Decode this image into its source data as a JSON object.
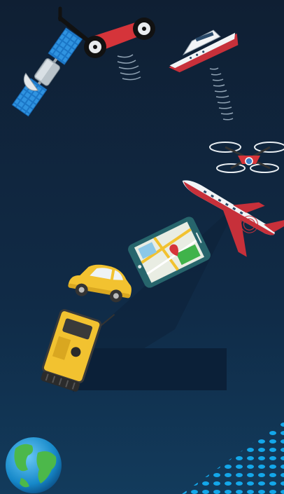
{
  "scene": {
    "elements": [
      "satellite-icon",
      "measuring-wheel-icon",
      "boat-icon",
      "drone-icon",
      "jet-icon",
      "smartphone-map-icon",
      "car-icon",
      "total-station-icon",
      "globe-icon"
    ],
    "colors": {
      "background_top": "#0f1f33",
      "background_bottom": "#123b5c",
      "dark_panel": "#0b2038",
      "accent_red": "#d5343a",
      "accent_yellow": "#f2c230",
      "accent_blue": "#1da1e6",
      "map_green": "#40b34a",
      "phone_teal": "#27656c"
    }
  }
}
